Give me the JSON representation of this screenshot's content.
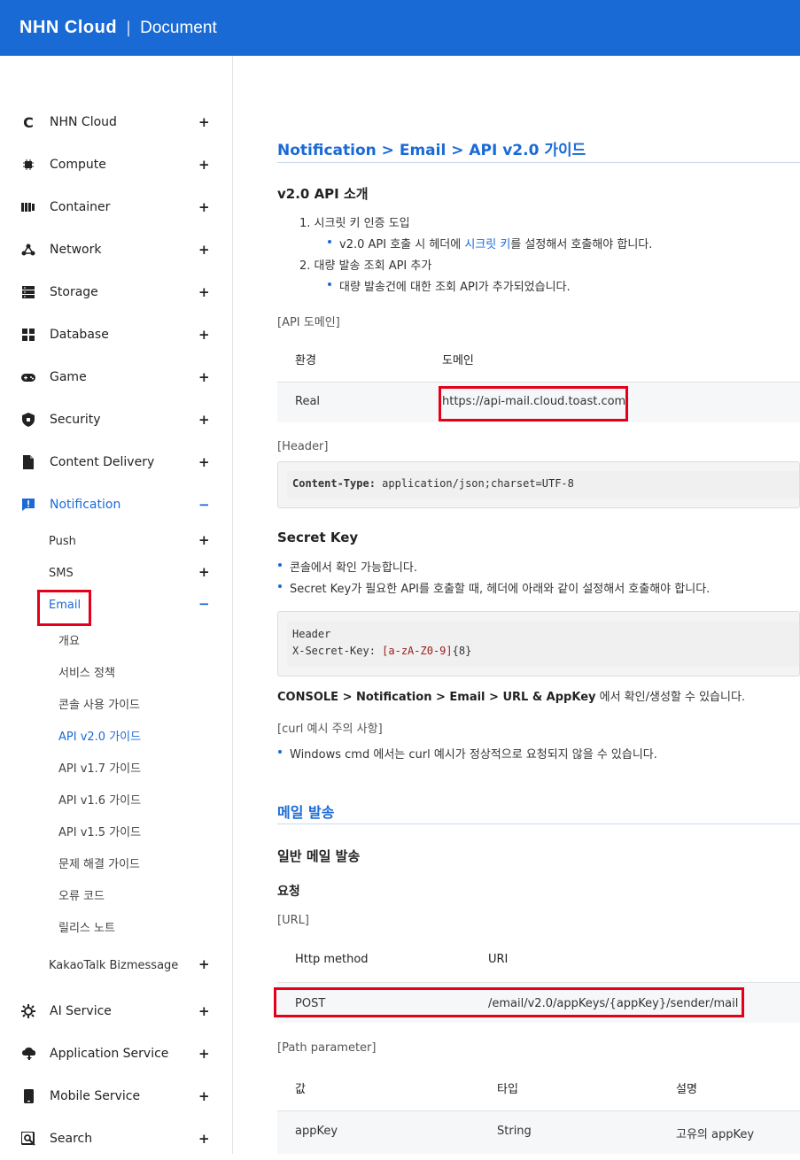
{
  "header": {
    "brand": "NHN Cloud",
    "separator": "|",
    "section": "Document"
  },
  "sidebar": {
    "top_items": [
      {
        "label": "NHN Cloud",
        "icon": "nhn-logo-icon",
        "toggle": "+"
      },
      {
        "label": "Compute",
        "icon": "chip-icon",
        "toggle": "+"
      },
      {
        "label": "Container",
        "icon": "container-icon",
        "toggle": "+"
      },
      {
        "label": "Network",
        "icon": "network-icon",
        "toggle": "+"
      },
      {
        "label": "Storage",
        "icon": "storage-icon",
        "toggle": "+"
      },
      {
        "label": "Database",
        "icon": "database-icon",
        "toggle": "+"
      },
      {
        "label": "Game",
        "icon": "gamepad-icon",
        "toggle": "+"
      },
      {
        "label": "Security",
        "icon": "shield-icon",
        "toggle": "+"
      },
      {
        "label": "Content Delivery",
        "icon": "document-icon",
        "toggle": "+"
      },
      {
        "label": "Notification",
        "icon": "alert-icon",
        "toggle": "−"
      }
    ],
    "notification_sub": [
      {
        "label": "Push",
        "toggle": "+"
      },
      {
        "label": "SMS",
        "toggle": "+"
      },
      {
        "label": "Email",
        "toggle": "−"
      }
    ],
    "email_pages": [
      "개요",
      "서비스 정책",
      "콘솔 사용 가이드",
      "API v2.0 가이드",
      "API v1.7 가이드",
      "API v1.6 가이드",
      "API v1.5 가이드",
      "문제 해결 가이드",
      "오류 코드",
      "릴리스 노트"
    ],
    "kakaotalk": {
      "label": "KakaoTalk Bizmessage",
      "toggle": "+"
    },
    "bottom_items": [
      {
        "label": "AI Service",
        "icon": "ai-icon",
        "toggle": "+"
      },
      {
        "label": "Application Service",
        "icon": "cloud-icon",
        "toggle": "+"
      },
      {
        "label": "Mobile Service",
        "icon": "mobile-icon",
        "toggle": "+"
      },
      {
        "label": "Search",
        "icon": "search-icon",
        "toggle": "+"
      }
    ]
  },
  "main": {
    "breadcrumb": "Notification > Email > API v2.0 가이드",
    "intro_title": "v2.0 API 소개",
    "intro_list": {
      "item1": "1. 시크릿 키 인증 도입",
      "item1_sub_pre": "v2.0 API 호출 시 헤더에 ",
      "item1_sub_link": "시크릿 키",
      "item1_sub_post": "를 설정해서 호출해야 합니다.",
      "item2": "2. 대량 발송 조회 API 추가",
      "item2_sub": "대량 발송건에 대한 조회 API가 추가되었습니다."
    },
    "api_domain_label": "[API 도메인]",
    "domain_table": {
      "headers": [
        "환경",
        "도메인"
      ],
      "row": [
        "Real",
        "https://api-mail.cloud.toast.com"
      ]
    },
    "header_label": "[Header]",
    "header_code_key": "Content-Type:",
    "header_code_value": " application/json;charset=UTF-8",
    "secret_title": "Secret Key",
    "secret_bullets": [
      "콘솔에서 확인 가능합니다.",
      "Secret Key가 필요한 API를 호출할 때, 헤더에 아래와 같이 설정해서 호출해야 합니다."
    ],
    "secret_code_line1": "Header",
    "secret_code_key": "X-Secret-Key:",
    "secret_code_regex": "[a-zA-Z0-9]",
    "secret_code_quant": "{8}",
    "console_bold": "CONSOLE > Notification > Email > URL & AppKey",
    "console_rest": " 에서 확인/생성할 수 있습니다.",
    "curl_label": "[curl 예시 주의 사항]",
    "curl_bullet": "Windows cmd 에서는 curl 예시가 정상적으로 요청되지 않을 수 있습니다.",
    "send_title": "메일 발송",
    "general_title": "일반 메일 발송",
    "request_title": "요청",
    "url_label": "[URL]",
    "url_table": {
      "headers": [
        "Http method",
        "URI"
      ],
      "row": [
        "POST",
        "/email/v2.0/appKeys/{appKey}/sender/mail"
      ]
    },
    "path_label": "[Path parameter]",
    "path_table": {
      "headers": [
        "값",
        "타입",
        "설명"
      ],
      "row": [
        "appKey",
        "String",
        "고유의 appKey"
      ]
    }
  }
}
